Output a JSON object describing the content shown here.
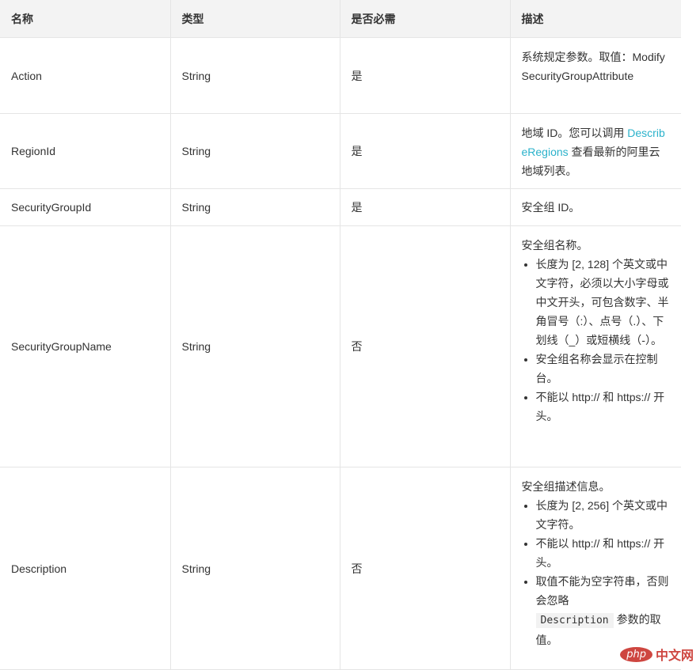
{
  "table": {
    "headers": [
      "名称",
      "类型",
      "是否必需",
      "描述"
    ],
    "rows": [
      {
        "name": "Action",
        "type": "String",
        "required": "是",
        "desc_text": "系统规定参数。取值：ModifySecurityGroupAttribute"
      },
      {
        "name": "RegionId",
        "type": "String",
        "required": "是",
        "desc_before": "地域 ID。您可以调用 ",
        "desc_link": "DescribeRegions",
        "desc_after": " 查看最新的阿里云地域列表。"
      },
      {
        "name": "SecurityGroupId",
        "type": "String",
        "required": "是",
        "desc_text": "安全组 ID。"
      },
      {
        "name": "SecurityGroupName",
        "type": "String",
        "required": "否",
        "desc_intro": "安全组名称。",
        "bullets": [
          "长度为 [2, 128] 个英文或中文字符，必须以大小字母或中文开头，可包含数字、半角冒号（:）、点号（.）、下划线（_）或短横线（-）。",
          "安全组名称会显示在控制台。",
          "不能以 http:// 和 https:// 开头。"
        ]
      },
      {
        "name": "Description",
        "type": "String",
        "required": "否",
        "desc_intro": "安全组描述信息。",
        "bullets": [
          "长度为 [2, 256] 个英文或中文字符。",
          "不能以 http:// 和 https:// 开头。"
        ],
        "bullet3_before": "取值不能为空字符串，否则会忽略",
        "bullet3_code": "Description",
        "bullet3_after": "参数的取值。"
      }
    ]
  },
  "watermark": {
    "logo": "php",
    "site": "中文网"
  }
}
